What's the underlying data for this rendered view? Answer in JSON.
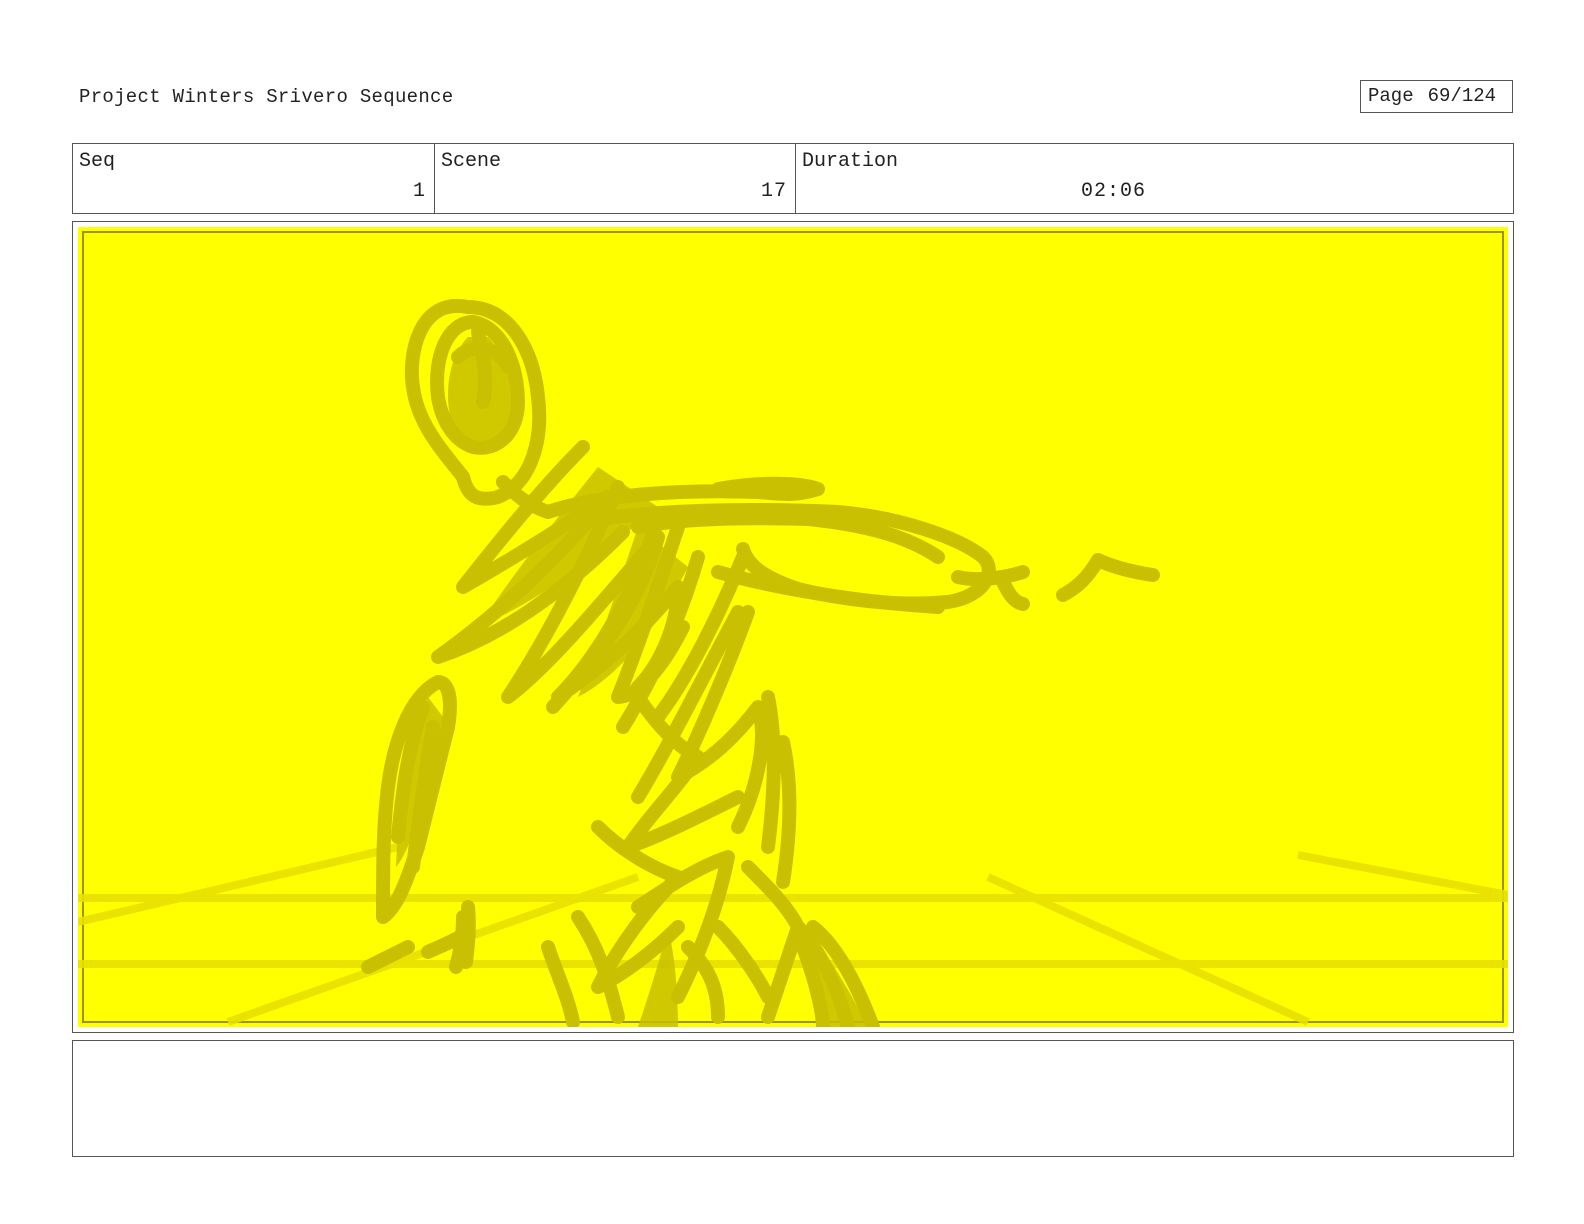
{
  "header": {
    "project_title": "Project Winters Srivero Sequence",
    "page_label": "Page",
    "page_number": "69/124"
  },
  "info": {
    "seq_label": "Seq",
    "seq_value": "1",
    "scene_label": "Scene",
    "scene_value": "17",
    "duration_label": "Duration",
    "duration_value": "02:06"
  },
  "panel": {
    "background_color": "#ffff00",
    "sketch_color": "#c8c000",
    "subject": "figure-sketch"
  },
  "notes": {
    "text": ""
  }
}
